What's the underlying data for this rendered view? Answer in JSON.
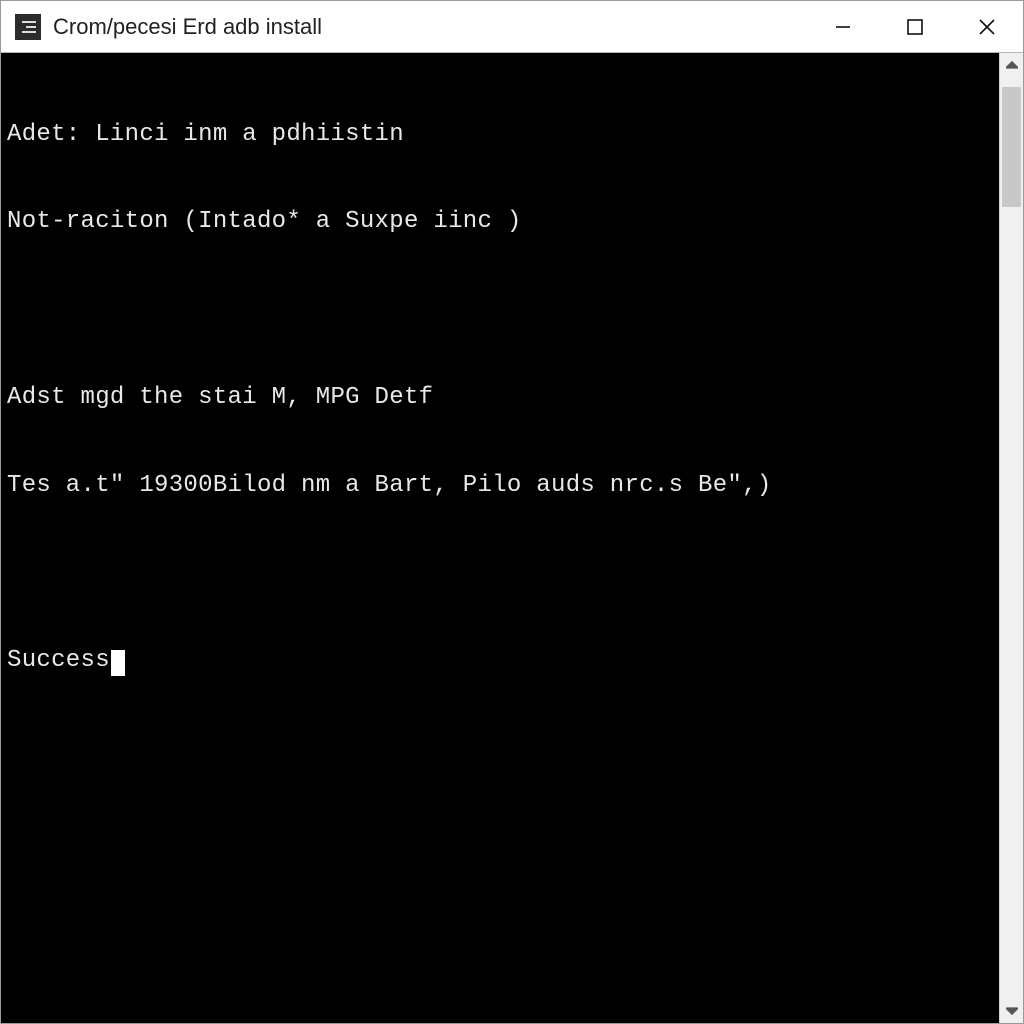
{
  "window": {
    "title": "Crom/pecesi Erd adb install"
  },
  "terminal": {
    "lines": [
      "Adet: Linci inm a pdhiistin",
      "Not-raciton (Intado* a Suxpe iinc )",
      "",
      "Adst mgd the stai M, MPG Detf",
      "Tes a.t\" 19300Bilod nm a Bart, Pilo auds nrc.s Be\",)",
      "",
      "Success"
    ]
  }
}
